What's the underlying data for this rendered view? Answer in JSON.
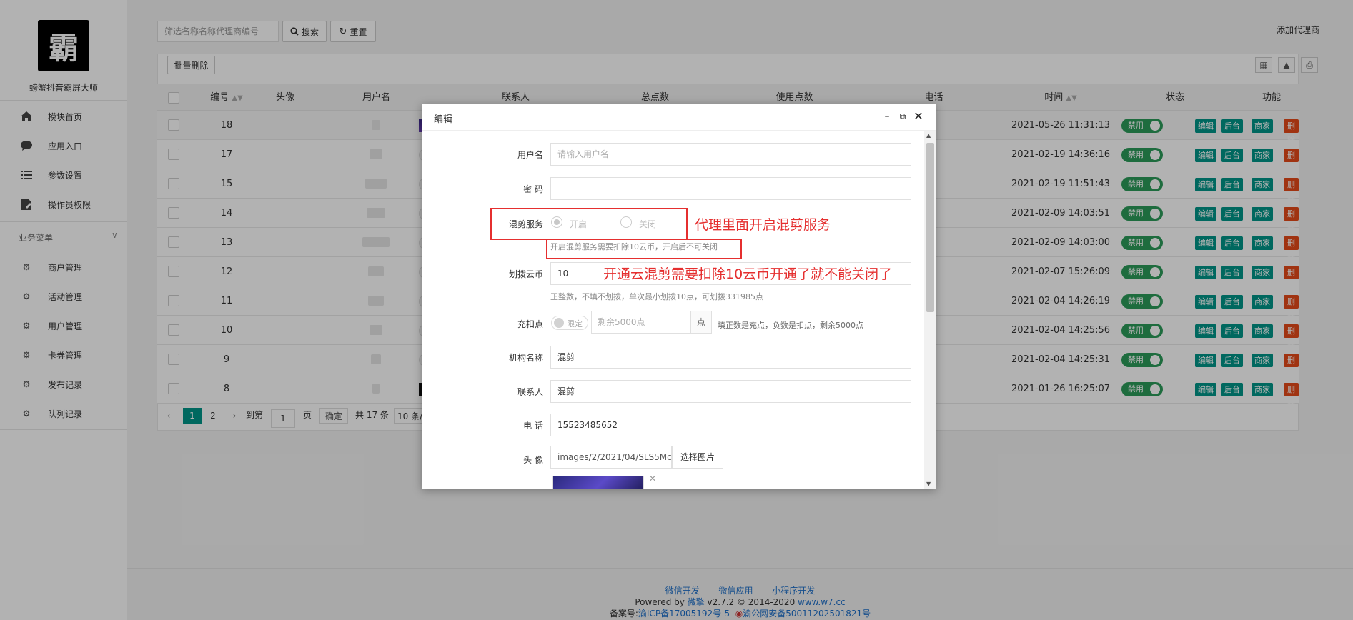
{
  "sidebar": {
    "logo_char": "霸",
    "app_name": "螃蟹抖音霸屏大师",
    "items": [
      {
        "label": "模块首页",
        "icon": "home-icon"
      },
      {
        "label": "应用入口",
        "icon": "chat-icon"
      },
      {
        "label": "参数设置",
        "icon": "list-icon"
      },
      {
        "label": "操作员权限",
        "icon": "document-edit-icon"
      }
    ],
    "group_label": "业务菜单",
    "group_items": [
      {
        "label": "商户管理"
      },
      {
        "label": "活动管理"
      },
      {
        "label": "用户管理"
      },
      {
        "label": "卡券管理"
      },
      {
        "label": "发布记录"
      },
      {
        "label": "队列记录"
      }
    ]
  },
  "toolbar": {
    "filter_placeholder": "筛选名称名称代理商编号",
    "search_label": "搜索",
    "reset_label": "重置",
    "add_agent_label": "添加代理商",
    "batch_delete_label": "批量删除"
  },
  "table": {
    "headers": [
      "编号",
      "头像",
      "用户名",
      "联系人",
      "总点数",
      "使用点数",
      "电话",
      "时间",
      "状态",
      "功能"
    ],
    "status_label": "禁用",
    "action_labels": [
      "编辑",
      "后台",
      "商家",
      "删除"
    ],
    "rows": [
      {
        "id": "18",
        "time": "2021-05-26 11:31:13"
      },
      {
        "id": "17",
        "time": "2021-02-19 14:36:16"
      },
      {
        "id": "15",
        "time": "2021-02-19 11:51:43"
      },
      {
        "id": "14",
        "time": "2021-02-09 14:03:51"
      },
      {
        "id": "13",
        "time": "2021-02-09 14:03:00"
      },
      {
        "id": "12",
        "time": "2021-02-07 15:26:09"
      },
      {
        "id": "11",
        "time": "2021-02-04 14:26:19"
      },
      {
        "id": "10",
        "time": "2021-02-04 14:25:56"
      },
      {
        "id": "9",
        "time": "2021-02-04 14:25:31"
      },
      {
        "id": "8",
        "time": "2021-01-26 16:25:07"
      }
    ]
  },
  "pagination": {
    "page1": "1",
    "page2": "2",
    "goto_label": "到第",
    "page_input": "1",
    "page_suffix": "页",
    "confirm_label": "确定",
    "total_label": "共 17 条",
    "per_page": "10 条/"
  },
  "footer": {
    "links": [
      "微信开发",
      "微信应用",
      "小程序开发"
    ],
    "powered_prefix": "Powered by ",
    "powered_brand": "微擎",
    "powered_version": " v2.7.2 © 2014-2020 ",
    "powered_site": "www.w7.cc",
    "icp_label": "备案号:",
    "icp_value": "渝ICP备17005192号-5",
    "police_value": "渝公网安备50011202501821号"
  },
  "modal": {
    "title": "编辑",
    "username_label": "用户名",
    "username_placeholder": "请输入用户名",
    "password_label": "密 码",
    "service_label": "混剪服务",
    "service_on": "开启",
    "service_off": "关闭",
    "service_hint": "开启混剪服务需要扣除10云币，开启后不可关闭",
    "transfer_label": "划拨云币",
    "transfer_value": "10",
    "transfer_hint": "正整数，不填不划拨，单次最小划拨10点，可划拨331985点",
    "recharge_label": "充扣点",
    "limit_label": "限定",
    "remaining_placeholder": "剩余5000点",
    "points_unit": "点",
    "recharge_hint": "填正数是充点，负数是扣点，剩余5000点",
    "org_label": "机构名称",
    "org_value": "混剪",
    "contact_label": "联系人",
    "contact_value": "混剪",
    "phone_label": "电 话",
    "phone_value": "15523485652",
    "avatar_label": "头 像",
    "avatar_value": "images/2/2021/04/SLS5Mc",
    "choose_image_label": "选择图片"
  },
  "annotations": {
    "note1": "代理里面开启混剪服务",
    "note2": "开通云混剪需要扣除10云币开通了就不能关闭了"
  },
  "colors": {
    "teal": "#009688",
    "red": "#e64a19",
    "green": "#2b9b5a",
    "annotation": "#e52f2f"
  }
}
